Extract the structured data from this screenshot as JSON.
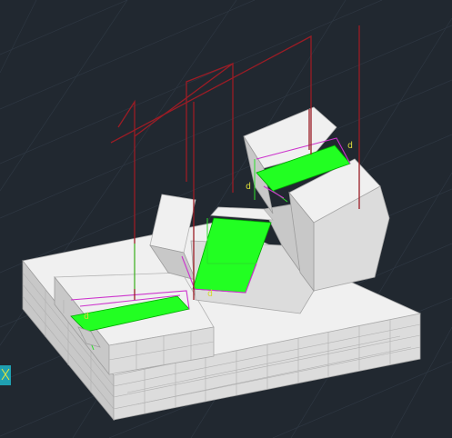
{
  "viewport": {
    "background_color": "#212830",
    "green_color": "#22ff22",
    "dimension_color": "#9b1c25",
    "highlight_color": "#cc33cc",
    "marker_color": "#d6d63a"
  },
  "markers": {
    "marker_1": "d",
    "marker_2": "d",
    "marker_3": "d",
    "marker_4": "d"
  }
}
